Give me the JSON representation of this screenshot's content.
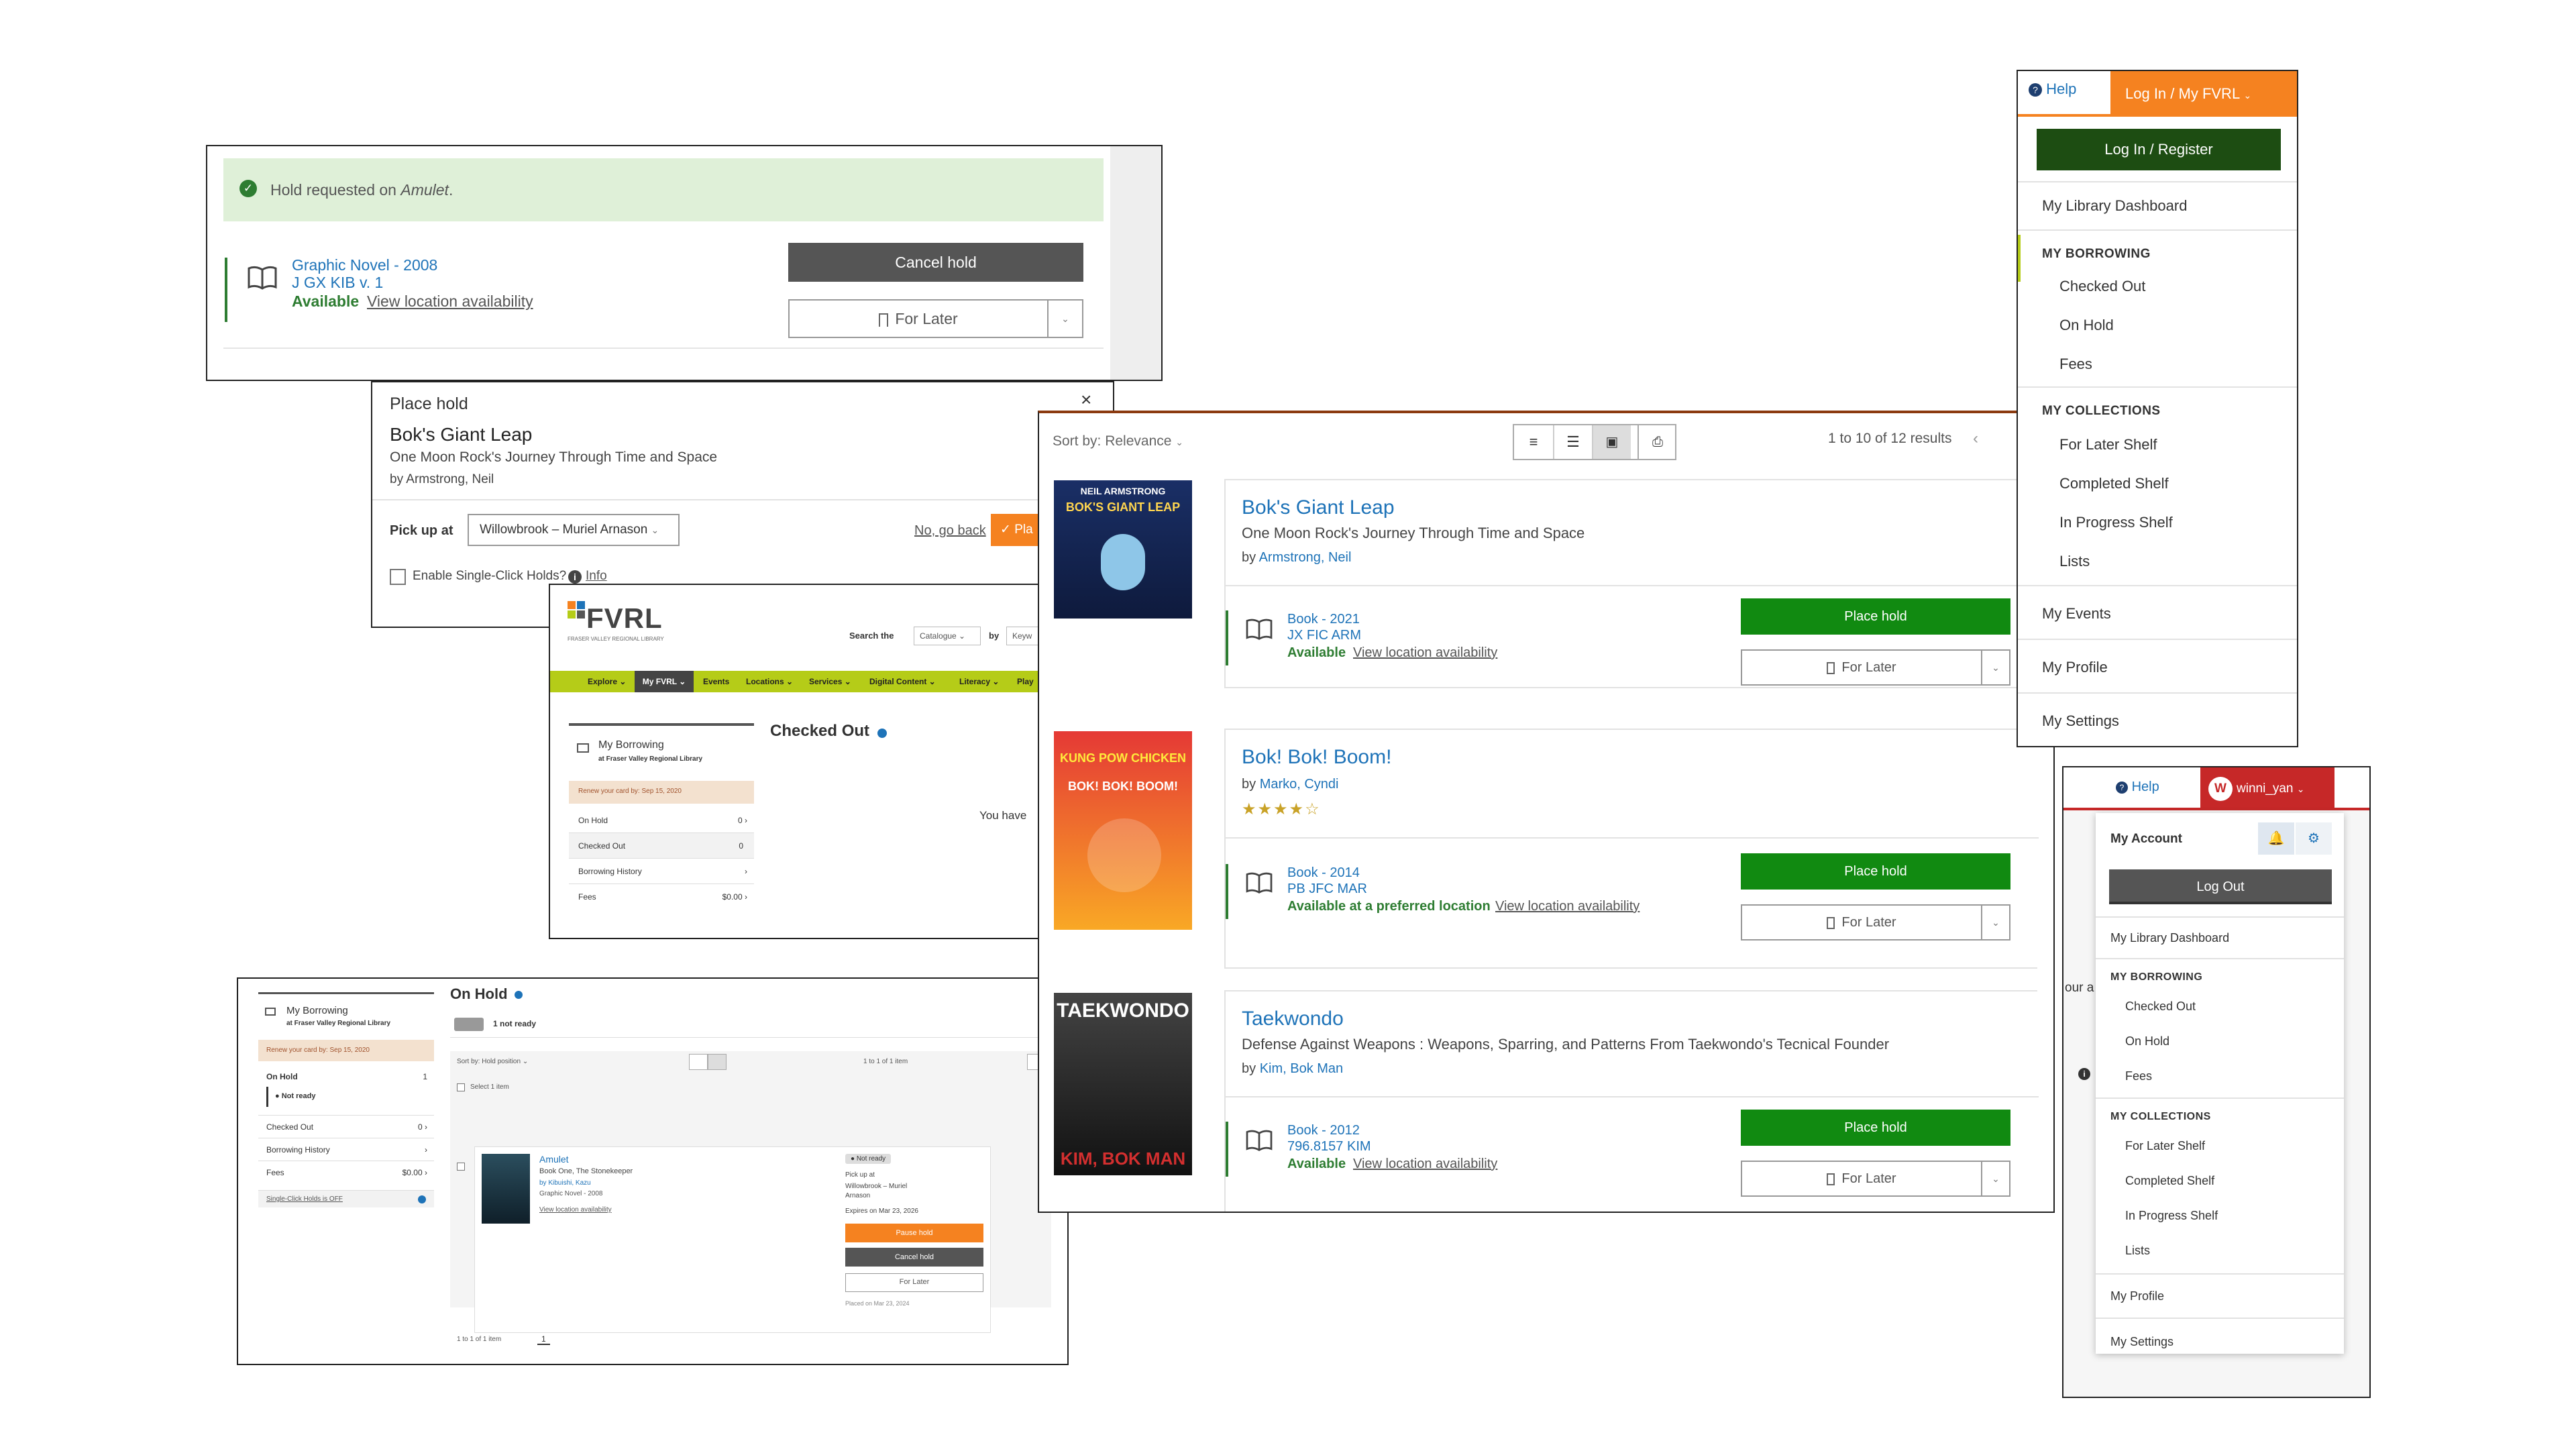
{
  "hold_confirm": {
    "message_prefix": "Hold requested on ",
    "message_title": "Amulet",
    "message_suffix": ".",
    "format_line": "Graphic Novel - 2008",
    "call_number": "J GX KIB v. 1",
    "status": "Available",
    "view_availability": "View location availability",
    "cancel_hold": "Cancel hold",
    "for_later": "For Later"
  },
  "place_hold": {
    "heading": "Place hold",
    "title": "Bok's Giant Leap",
    "subtitle": "One Moon Rock's Journey Through Time and Space",
    "author": "by Armstrong, Neil",
    "pickup_label": "Pick up at",
    "pickup_value": "Willowbrook – Muriel Arnason",
    "go_back": "No, go back",
    "place_label": "Pla",
    "single_click": "Enable Single-Click Holds?",
    "info": "Info",
    "close": "×"
  },
  "fvrl_site": {
    "logo_text": "FVRL",
    "logo_sub": "FRASER VALLEY REGIONAL LIBRARY",
    "search_label": "Search the",
    "search_scope": "Catalogue",
    "by_label": "by",
    "search_type": "Keyw",
    "nav": [
      "Explore",
      "My FVRL",
      "Events",
      "Locations",
      "Services",
      "Digital Content",
      "Literacy",
      "Play"
    ],
    "sidebar_title": "My Borrowing",
    "sidebar_sub": "at Fraser Valley Regional Library",
    "renew": "Renew your card by: Sep 15, 2020",
    "rows": [
      {
        "label": "On Hold",
        "count": "0"
      },
      {
        "label": "Checked Out",
        "count": "0"
      },
      {
        "label": "Borrowing History",
        "count": ""
      },
      {
        "label": "Fees",
        "count": "$0.00"
      }
    ],
    "page_title": "Checked Out",
    "you_have": "You have"
  },
  "on_hold_page": {
    "sidebar_title": "My Borrowing",
    "sidebar_sub": "at Fraser Valley Regional Library",
    "renew": "Renew your card by: Sep 15, 2020",
    "rows": [
      {
        "label": "On Hold",
        "count": "1"
      },
      {
        "label": "Not ready",
        "count": ""
      },
      {
        "label": "Checked Out",
        "count": "0"
      },
      {
        "label": "Borrowing History",
        "count": ""
      },
      {
        "label": "Fees",
        "count": "$0.00"
      }
    ],
    "single_click": "Single-Click Holds is OFF",
    "page_title": "On Hold",
    "filter_chip": "1 not ready",
    "sort": "Sort by: Hold position",
    "range": "1 to 1 of 1 item",
    "select_label": "Select 1 item",
    "item_title": "Amulet",
    "item_sub": "Book One, The Stonekeeper",
    "item_author": "by Kibuishi, Kazu",
    "item_format": "Graphic Novel - 2008",
    "item_view": "View location availability",
    "status_badge": "Not ready",
    "pickup_at": "Pick up at",
    "pickup_place": "Willowbrook – Muriel Arnason",
    "expires": "Expires on Mar 23, 2026",
    "pause": "Pause hold",
    "cancel": "Cancel hold",
    "for_later": "For Later",
    "placed": "Placed on Mar 23, 2024",
    "footer_range": "1 to 1 of 1 item",
    "page_num": "1"
  },
  "results": {
    "sort": "Sort by: Relevance",
    "range": "1 to 10 of 12 results",
    "items": [
      {
        "title": "Bok's Giant Leap",
        "subtitle": "One Moon Rock's Journey Through Time and Space",
        "by": "by ",
        "author": "Armstrong, Neil",
        "format": "Book - 2021",
        "call": "JX FIC ARM",
        "status": "Available",
        "view": "View location availability",
        "place": "Place hold",
        "later": "For Later",
        "cover_top": "NEIL ARMSTRONG",
        "cover_title": "BOK'S GIANT LEAP"
      },
      {
        "title": "Bok! Bok! Boom!",
        "subtitle": "",
        "by": "by ",
        "author": "Marko, Cyndi",
        "rating": 4,
        "format": "Book - 2014",
        "call": "PB JFC MAR",
        "status": "Available at a preferred location",
        "view": "View location availability",
        "place": "Place hold",
        "later": "For Later",
        "cover_top": "KUNG POW CHICKEN",
        "cover_title": "BOK! BOK! BOOM!"
      },
      {
        "title": "Taekwondo",
        "subtitle": "Defense Against Weapons : Weapons, Sparring, and Patterns From Taekwondo's Tecnical Founder",
        "by": "by ",
        "author": "Kim, Bok Man",
        "format": "Book - 2012",
        "call": "796.8157 KIM",
        "status": "Available",
        "view": "View location availability",
        "place": "Place hold",
        "later": "For Later",
        "cover_top": "TAEKWONDO",
        "cover_title": "KIM, BOK MAN"
      }
    ]
  },
  "menu_guest": {
    "help": "Help",
    "login_tab": "Log In / My FVRL",
    "login_btn": "Log In / Register",
    "dashboard": "My Library Dashboard",
    "borrowing_head": "MY BORROWING",
    "borrowing": [
      "Checked Out",
      "On Hold",
      "Fees"
    ],
    "collections_head": "MY COLLECTIONS",
    "collections": [
      "For Later Shelf",
      "Completed Shelf",
      "In Progress Shelf",
      "Lists"
    ],
    "events": "My Events",
    "profile": "My Profile",
    "settings": "My Settings"
  },
  "menu_user": {
    "help": "Help",
    "avatar": "W",
    "username": "winni_yan",
    "account": "My Account",
    "logout": "Log Out",
    "dashboard": "My Library Dashboard",
    "borrowing_head": "MY BORROWING",
    "borrowing": [
      "Checked Out",
      "On Hold",
      "Fees"
    ],
    "collections_head": "MY COLLECTIONS",
    "collections": [
      "For Later Shelf",
      "Completed Shelf",
      "In Progress Shelf",
      "Lists"
    ],
    "profile": "My Profile",
    "settings": "My Settings",
    "behind_text": "our a"
  },
  "colors": {
    "orange": "#f58220",
    "green_btn": "#118a11",
    "link_blue": "#1e73b8",
    "avail_green": "#2e7d32",
    "dark_green": "#1d4d12",
    "user_red": "#c62828",
    "fvrl_nav": "#b5cc18"
  }
}
